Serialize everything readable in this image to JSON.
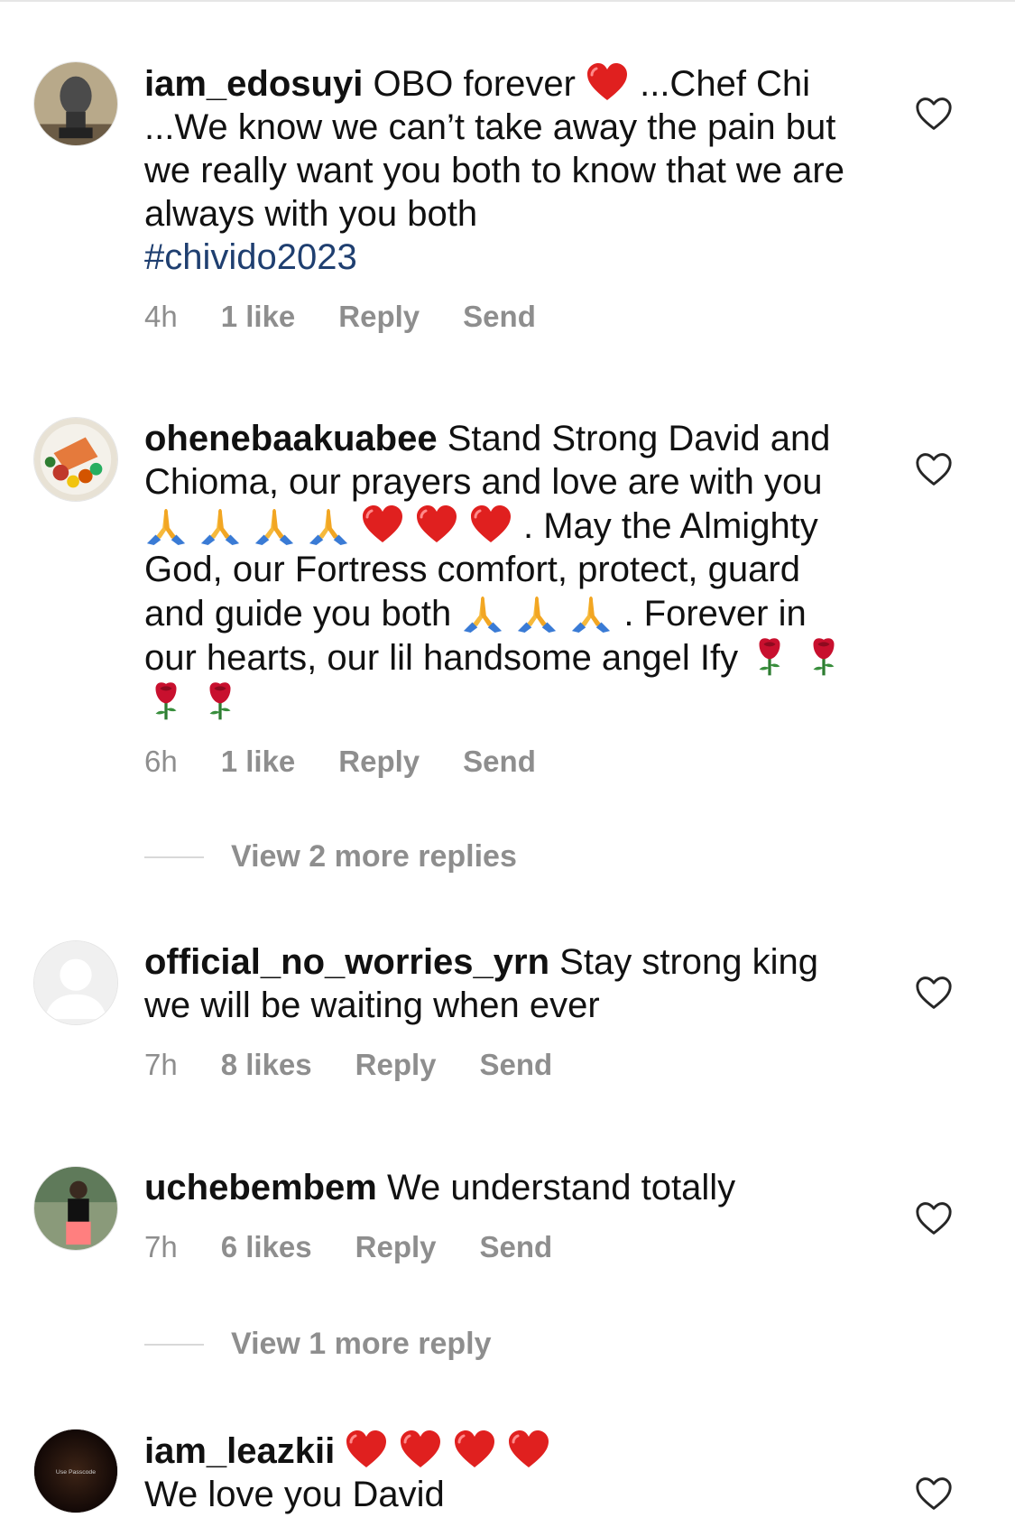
{
  "comments": [
    {
      "username": "iam_edosuyi",
      "text": "OBO forever",
      "text_after": "...Chef Chi ...We know we can’t take away the pain but we really want you both to know that we are always with you both",
      "hashtag": "#chivido2023",
      "time": "4h",
      "likes": "1 like",
      "reply": "Reply",
      "send": "Send"
    },
    {
      "username": "ohenebaakuabee",
      "text": "Stand Strong David and Chioma, our prayers and love are with you",
      "text_mid": ". May the Almighty God, our Fortress comfort, protect, guard and guide you both",
      "text_end": ". Forever in our hearts, our lil handsome angel Ify",
      "time": "6h",
      "likes": "1 like",
      "reply": "Reply",
      "send": "Send"
    },
    {
      "username": "official_no_worries_yrn",
      "text": "Stay strong king we will be waiting when ever",
      "time": "7h",
      "likes": "8 likes",
      "reply": "Reply",
      "send": "Send"
    },
    {
      "username": "uchebembem",
      "text": "We understand totally",
      "time": "7h",
      "likes": "6 likes",
      "reply": "Reply",
      "send": "Send"
    },
    {
      "username": "iam_leazkii",
      "text": "We love you David",
      "avatar_caption": "Use Passcode"
    }
  ],
  "view_replies_1": "View 2 more replies",
  "view_replies_2": "View 1 more reply",
  "icons": {
    "like": "heart-outline-icon",
    "heart": "red-heart-emoji",
    "pray": "folded-hands-emoji",
    "rose": "rose-emoji"
  },
  "colors": {
    "username": "#111111",
    "meta": "#8e8e8e",
    "hashtag": "#1f3f70",
    "heart": "#e0201f"
  }
}
